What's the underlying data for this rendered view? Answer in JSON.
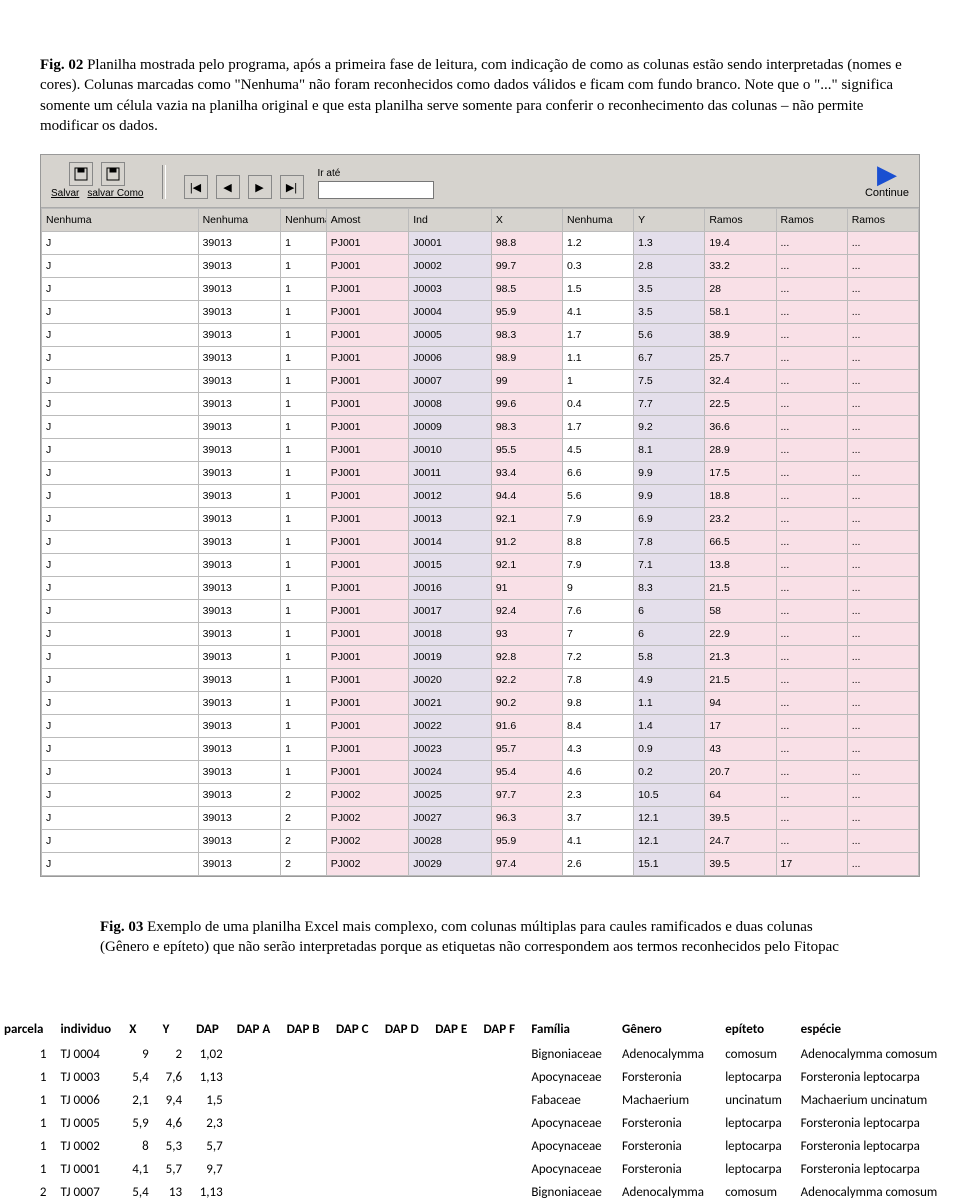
{
  "caption1_bold": "Fig. 02",
  "caption1_rest": " Planilha mostrada pelo programa, após a primeira fase de leitura, com indicação de como as colunas estão sendo interpretadas (nomes e cores). Colunas marcadas como \"Nenhuma\" não foram reconhecidos como dados válidos e ficam com fundo branco. Note que o \"...\" significa somente um célula vazia na planilha original e que esta planilha serve somente para conferir o reconhecimento das colunas – não permite modificar os dados.",
  "toolbar": {
    "salvar": "Salvar",
    "salvar_como": "salvar Como",
    "irate_label": "Ir até",
    "irate_value": "",
    "continue": "Continue"
  },
  "headers": [
    "Nenhuma",
    "Nenhuma",
    "Nenhuma",
    "Amost",
    "Ind",
    "X",
    "Nenhuma",
    "Y",
    "Ramos",
    "Ramos",
    "Ramos"
  ],
  "rows": [
    [
      "J",
      "39013",
      "1",
      "PJ001",
      "J0001",
      "98.8",
      "1.2",
      "1.3",
      "19.4",
      "...",
      "..."
    ],
    [
      "J",
      "39013",
      "1",
      "PJ001",
      "J0002",
      "99.7",
      "0.3",
      "2.8",
      "33.2",
      "...",
      "..."
    ],
    [
      "J",
      "39013",
      "1",
      "PJ001",
      "J0003",
      "98.5",
      "1.5",
      "3.5",
      "28",
      "...",
      "..."
    ],
    [
      "J",
      "39013",
      "1",
      "PJ001",
      "J0004",
      "95.9",
      "4.1",
      "3.5",
      "58.1",
      "...",
      "..."
    ],
    [
      "J",
      "39013",
      "1",
      "PJ001",
      "J0005",
      "98.3",
      "1.7",
      "5.6",
      "38.9",
      "...",
      "..."
    ],
    [
      "J",
      "39013",
      "1",
      "PJ001",
      "J0006",
      "98.9",
      "1.1",
      "6.7",
      "25.7",
      "...",
      "..."
    ],
    [
      "J",
      "39013",
      "1",
      "PJ001",
      "J0007",
      "99",
      "1",
      "7.5",
      "32.4",
      "...",
      "..."
    ],
    [
      "J",
      "39013",
      "1",
      "PJ001",
      "J0008",
      "99.6",
      "0.4",
      "7.7",
      "22.5",
      "...",
      "..."
    ],
    [
      "J",
      "39013",
      "1",
      "PJ001",
      "J0009",
      "98.3",
      "1.7",
      "9.2",
      "36.6",
      "...",
      "..."
    ],
    [
      "J",
      "39013",
      "1",
      "PJ001",
      "J0010",
      "95.5",
      "4.5",
      "8.1",
      "28.9",
      "...",
      "..."
    ],
    [
      "J",
      "39013",
      "1",
      "PJ001",
      "J0011",
      "93.4",
      "6.6",
      "9.9",
      "17.5",
      "...",
      "..."
    ],
    [
      "J",
      "39013",
      "1",
      "PJ001",
      "J0012",
      "94.4",
      "5.6",
      "9.9",
      "18.8",
      "...",
      "..."
    ],
    [
      "J",
      "39013",
      "1",
      "PJ001",
      "J0013",
      "92.1",
      "7.9",
      "6.9",
      "23.2",
      "...",
      "..."
    ],
    [
      "J",
      "39013",
      "1",
      "PJ001",
      "J0014",
      "91.2",
      "8.8",
      "7.8",
      "66.5",
      "...",
      "..."
    ],
    [
      "J",
      "39013",
      "1",
      "PJ001",
      "J0015",
      "92.1",
      "7.9",
      "7.1",
      "13.8",
      "...",
      "..."
    ],
    [
      "J",
      "39013",
      "1",
      "PJ001",
      "J0016",
      "91",
      "9",
      "8.3",
      "21.5",
      "...",
      "..."
    ],
    [
      "J",
      "39013",
      "1",
      "PJ001",
      "J0017",
      "92.4",
      "7.6",
      "6",
      "58",
      "...",
      "..."
    ],
    [
      "J",
      "39013",
      "1",
      "PJ001",
      "J0018",
      "93",
      "7",
      "6",
      "22.9",
      "...",
      "..."
    ],
    [
      "J",
      "39013",
      "1",
      "PJ001",
      "J0019",
      "92.8",
      "7.2",
      "5.8",
      "21.3",
      "...",
      "..."
    ],
    [
      "J",
      "39013",
      "1",
      "PJ001",
      "J0020",
      "92.2",
      "7.8",
      "4.9",
      "21.5",
      "...",
      "..."
    ],
    [
      "J",
      "39013",
      "1",
      "PJ001",
      "J0021",
      "90.2",
      "9.8",
      "1.1",
      "94",
      "...",
      "..."
    ],
    [
      "J",
      "39013",
      "1",
      "PJ001",
      "J0022",
      "91.6",
      "8.4",
      "1.4",
      "17",
      "...",
      "..."
    ],
    [
      "J",
      "39013",
      "1",
      "PJ001",
      "J0023",
      "95.7",
      "4.3",
      "0.9",
      "43",
      "...",
      "..."
    ],
    [
      "J",
      "39013",
      "1",
      "PJ001",
      "J0024",
      "95.4",
      "4.6",
      "0.2",
      "20.7",
      "...",
      "..."
    ],
    [
      "J",
      "39013",
      "2",
      "PJ002",
      "J0025",
      "97.7",
      "2.3",
      "10.5",
      "64",
      "...",
      "..."
    ],
    [
      "J",
      "39013",
      "2",
      "PJ002",
      "J0027",
      "96.3",
      "3.7",
      "12.1",
      "39.5",
      "...",
      "..."
    ],
    [
      "J",
      "39013",
      "2",
      "PJ002",
      "J0028",
      "95.9",
      "4.1",
      "12.1",
      "24.7",
      "...",
      "..."
    ],
    [
      "J",
      "39013",
      "2",
      "PJ002",
      "J0029",
      "97.4",
      "2.6",
      "15.1",
      "39.5",
      "17",
      "..."
    ]
  ],
  "caption2_bold": "Fig. 03",
  "caption2_rest": " Exemplo de uma planilha Excel mais complexo, com colunas múltiplas para caules ramificados e duas colunas (Gênero e epíteto) que não serão interpretadas porque as etiquetas não correspondem aos termos reconhecidos pelo Fitopac",
  "excel_headers": [
    "parcela",
    "individuo",
    "X",
    "Y",
    "DAP",
    "DAP A",
    "DAP B",
    "DAP C",
    "DAP D",
    "DAP E",
    "DAP F",
    "Família",
    "Gênero",
    "epíteto",
    "espécie"
  ],
  "excel_rows": [
    [
      "1",
      "TJ 0004",
      "9",
      "2",
      "1,02",
      "",
      "",
      "",
      "",
      "",
      "",
      "Bignoniaceae",
      "Adenocalymma",
      "comosum",
      "Adenocalymma comosum"
    ],
    [
      "1",
      "TJ 0003",
      "5,4",
      "7,6",
      "1,13",
      "",
      "",
      "",
      "",
      "",
      "",
      "Apocynaceae",
      "Forsteronia",
      "leptocarpa",
      "Forsteronia leptocarpa"
    ],
    [
      "1",
      "TJ 0006",
      "2,1",
      "9,4",
      "1,5",
      "",
      "",
      "",
      "",
      "",
      "",
      "Fabaceae",
      "Machaerium",
      "uncinatum",
      "Machaerium uncinatum"
    ],
    [
      "1",
      "TJ 0005",
      "5,9",
      "4,6",
      "2,3",
      "",
      "",
      "",
      "",
      "",
      "",
      "Apocynaceae",
      "Forsteronia",
      "leptocarpa",
      "Forsteronia leptocarpa"
    ],
    [
      "1",
      "TJ 0002",
      "8",
      "5,3",
      "5,7",
      "",
      "",
      "",
      "",
      "",
      "",
      "Apocynaceae",
      "Forsteronia",
      "leptocarpa",
      "Forsteronia leptocarpa"
    ],
    [
      "1",
      "TJ 0001",
      "4,1",
      "5,7",
      "9,7",
      "",
      "",
      "",
      "",
      "",
      "",
      "Apocynaceae",
      "Forsteronia",
      "leptocarpa",
      "Forsteronia leptocarpa"
    ],
    [
      "2",
      "TJ 0007",
      "5,4",
      "13",
      "1,13",
      "",
      "",
      "",
      "",
      "",
      "",
      "Bignoniaceae",
      "Adenocalymma",
      "comosum",
      "Adenocalymma comosum"
    ]
  ]
}
